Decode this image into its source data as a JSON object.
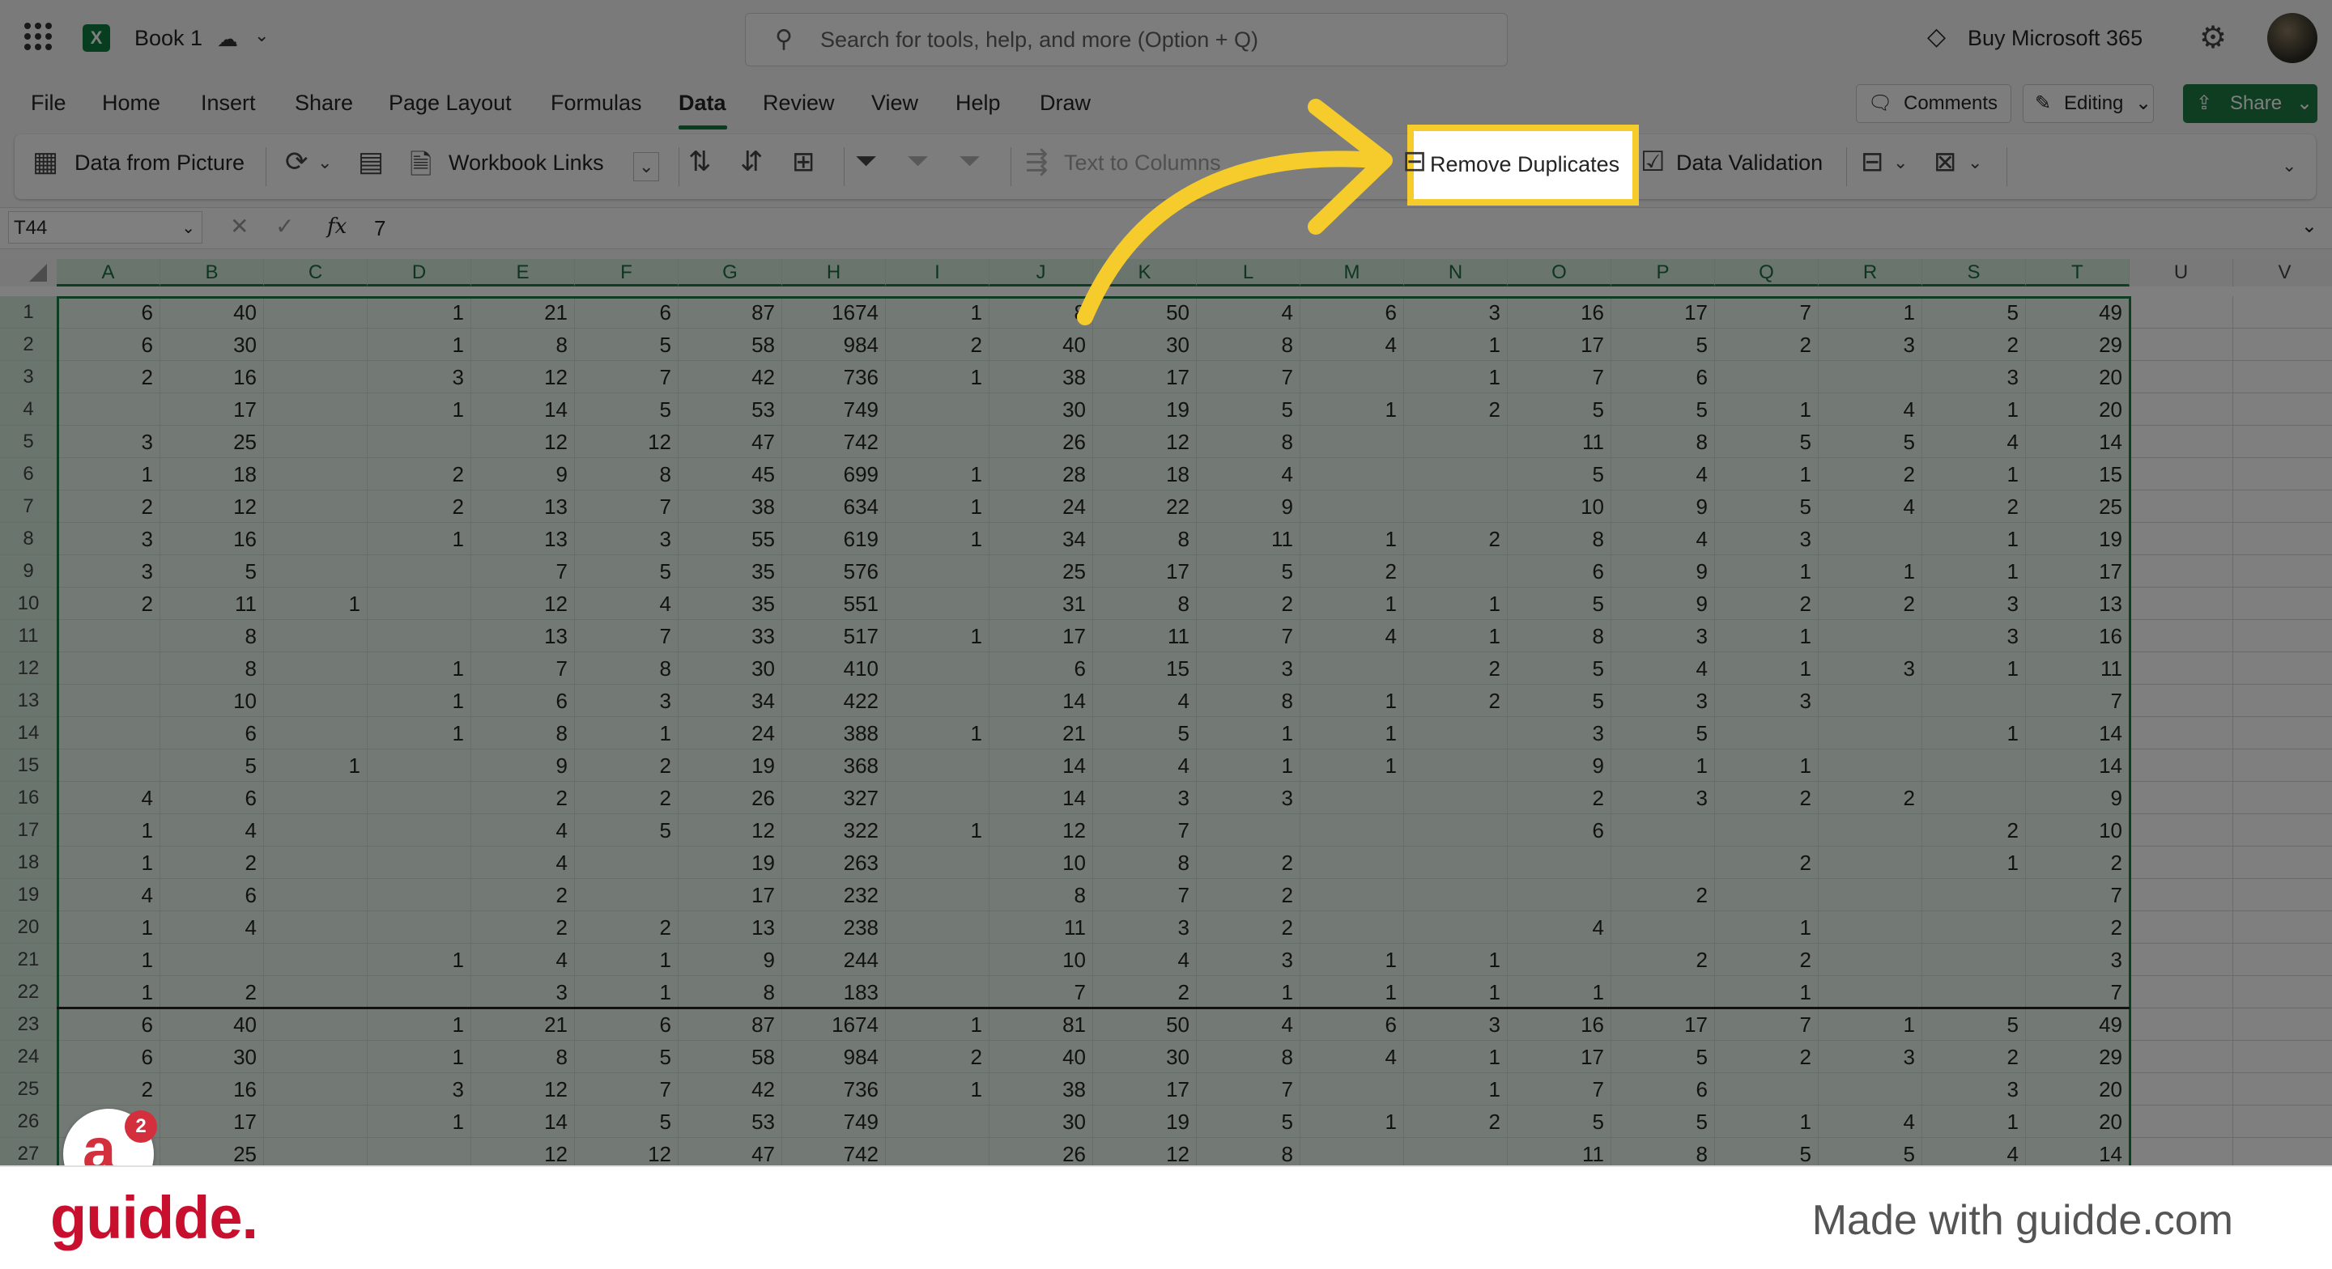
{
  "titlebar": {
    "book_title": "Book 1",
    "search_placeholder": "Search for tools, help, and more (Option + Q)",
    "buy_label": "Buy Microsoft 365"
  },
  "menu": [
    "File",
    "Home",
    "Insert",
    "Share",
    "Page Layout",
    "Formulas",
    "Data",
    "Review",
    "View",
    "Help",
    "Draw"
  ],
  "menu_active": "Data",
  "actions": {
    "comments": "Comments",
    "editing": "Editing",
    "share": "Share"
  },
  "ribbon": {
    "data_from_picture": "Data from Picture",
    "workbook_links": "Workbook Links",
    "text_to_columns": "Text to Columns",
    "remove_duplicates": "Remove Duplicates",
    "data_validation": "Data Validation"
  },
  "formula_bar": {
    "name_box": "T44",
    "fx": "fx",
    "value": "7"
  },
  "columns": [
    "A",
    "B",
    "C",
    "D",
    "E",
    "F",
    "G",
    "H",
    "I",
    "J",
    "K",
    "L",
    "M",
    "N",
    "O",
    "P",
    "Q",
    "R",
    "S",
    "T",
    "U",
    "V"
  ],
  "rows": [
    [
      "6",
      "40",
      "",
      "1",
      "21",
      "6",
      "87",
      "1674",
      "1",
      "8",
      "50",
      "4",
      "6",
      "3",
      "16",
      "17",
      "7",
      "1",
      "5",
      "49"
    ],
    [
      "6",
      "30",
      "",
      "1",
      "8",
      "5",
      "58",
      "984",
      "2",
      "40",
      "30",
      "8",
      "4",
      "1",
      "17",
      "5",
      "2",
      "3",
      "2",
      "29"
    ],
    [
      "2",
      "16",
      "",
      "3",
      "12",
      "7",
      "42",
      "736",
      "1",
      "38",
      "17",
      "7",
      "",
      "1",
      "7",
      "6",
      "",
      "",
      "3",
      "20"
    ],
    [
      "",
      "17",
      "",
      "1",
      "14",
      "5",
      "53",
      "749",
      "",
      "30",
      "19",
      "5",
      "1",
      "2",
      "5",
      "5",
      "1",
      "4",
      "1",
      "20"
    ],
    [
      "3",
      "25",
      "",
      "",
      "12",
      "12",
      "47",
      "742",
      "",
      "26",
      "12",
      "8",
      "",
      "",
      "11",
      "8",
      "5",
      "5",
      "4",
      "14"
    ],
    [
      "1",
      "18",
      "",
      "2",
      "9",
      "8",
      "45",
      "699",
      "1",
      "28",
      "18",
      "4",
      "",
      "",
      "5",
      "4",
      "1",
      "2",
      "1",
      "15"
    ],
    [
      "2",
      "12",
      "",
      "2",
      "13",
      "7",
      "38",
      "634",
      "1",
      "24",
      "22",
      "9",
      "",
      "",
      "10",
      "9",
      "5",
      "4",
      "2",
      "25"
    ],
    [
      "3",
      "16",
      "",
      "1",
      "13",
      "3",
      "55",
      "619",
      "1",
      "34",
      "8",
      "11",
      "1",
      "2",
      "8",
      "4",
      "3",
      "",
      "1",
      "19"
    ],
    [
      "3",
      "5",
      "",
      "",
      "7",
      "5",
      "35",
      "576",
      "",
      "25",
      "17",
      "5",
      "2",
      "",
      "6",
      "9",
      "1",
      "1",
      "1",
      "17"
    ],
    [
      "2",
      "11",
      "1",
      "",
      "12",
      "4",
      "35",
      "551",
      "",
      "31",
      "8",
      "2",
      "1",
      "1",
      "5",
      "9",
      "2",
      "2",
      "3",
      "13"
    ],
    [
      "",
      "8",
      "",
      "",
      "13",
      "7",
      "33",
      "517",
      "1",
      "17",
      "11",
      "7",
      "4",
      "1",
      "8",
      "3",
      "1",
      "",
      "3",
      "16"
    ],
    [
      "",
      "8",
      "",
      "1",
      "7",
      "8",
      "30",
      "410",
      "",
      "6",
      "15",
      "3",
      "",
      "2",
      "5",
      "4",
      "1",
      "3",
      "1",
      "11"
    ],
    [
      "",
      "10",
      "",
      "1",
      "6",
      "3",
      "34",
      "422",
      "",
      "14",
      "4",
      "8",
      "1",
      "2",
      "5",
      "3",
      "3",
      "",
      "",
      "7"
    ],
    [
      "",
      "6",
      "",
      "1",
      "8",
      "1",
      "24",
      "388",
      "1",
      "21",
      "5",
      "1",
      "1",
      "",
      "3",
      "5",
      "",
      "",
      "1",
      "14"
    ],
    [
      "",
      "5",
      "1",
      "",
      "9",
      "2",
      "19",
      "368",
      "",
      "14",
      "4",
      "1",
      "1",
      "",
      "9",
      "1",
      "1",
      "",
      "",
      "14"
    ],
    [
      "4",
      "6",
      "",
      "",
      "2",
      "2",
      "26",
      "327",
      "",
      "14",
      "3",
      "3",
      "",
      "",
      "2",
      "3",
      "2",
      "2",
      "",
      "9"
    ],
    [
      "1",
      "4",
      "",
      "",
      "4",
      "5",
      "12",
      "322",
      "1",
      "12",
      "7",
      "",
      "",
      "",
      "6",
      "",
      "",
      "",
      "2",
      "10"
    ],
    [
      "1",
      "2",
      "",
      "",
      "4",
      "",
      "19",
      "263",
      "",
      "10",
      "8",
      "2",
      "",
      "",
      "",
      "",
      "2",
      "",
      "1",
      "2"
    ],
    [
      "4",
      "6",
      "",
      "",
      "2",
      "",
      "17",
      "232",
      "",
      "8",
      "7",
      "2",
      "",
      "",
      "",
      "2",
      "",
      "",
      "",
      "7"
    ],
    [
      "1",
      "4",
      "",
      "",
      "2",
      "2",
      "13",
      "238",
      "",
      "11",
      "3",
      "2",
      "",
      "",
      "4",
      "",
      "1",
      "",
      "",
      "2"
    ],
    [
      "1",
      "",
      "",
      "1",
      "4",
      "1",
      "9",
      "244",
      "",
      "10",
      "4",
      "3",
      "1",
      "1",
      "",
      "2",
      "2",
      "",
      "",
      "3"
    ],
    [
      "1",
      "2",
      "",
      "",
      "3",
      "1",
      "8",
      "183",
      "",
      "7",
      "2",
      "1",
      "1",
      "1",
      "1",
      "",
      "1",
      "",
      "",
      "7"
    ],
    [
      "6",
      "40",
      "",
      "1",
      "21",
      "6",
      "87",
      "1674",
      "1",
      "81",
      "50",
      "4",
      "6",
      "3",
      "16",
      "17",
      "7",
      "1",
      "5",
      "49"
    ],
    [
      "6",
      "30",
      "",
      "1",
      "8",
      "5",
      "58",
      "984",
      "2",
      "40",
      "30",
      "8",
      "4",
      "1",
      "17",
      "5",
      "2",
      "3",
      "2",
      "29"
    ],
    [
      "2",
      "16",
      "",
      "3",
      "12",
      "7",
      "42",
      "736",
      "1",
      "38",
      "17",
      "7",
      "",
      "1",
      "7",
      "6",
      "",
      "",
      "3",
      "20"
    ],
    [
      "",
      "17",
      "",
      "1",
      "14",
      "5",
      "53",
      "749",
      "",
      "30",
      "19",
      "5",
      "1",
      "2",
      "5",
      "5",
      "1",
      "4",
      "1",
      "20"
    ],
    [
      "",
      "25",
      "",
      "",
      "12",
      "12",
      "47",
      "742",
      "",
      "26",
      "12",
      "8",
      "",
      "",
      "11",
      "8",
      "5",
      "5",
      "4",
      "14"
    ]
  ],
  "guidde_badge": {
    "letter": "a",
    "count": "2"
  },
  "footer": {
    "logo": "guidde.",
    "made_with": "Made with guidde.com"
  },
  "colors": {
    "excel_green": "#107c41",
    "highlight": "#f5cc2c",
    "guidde_red": "#c8102e"
  }
}
